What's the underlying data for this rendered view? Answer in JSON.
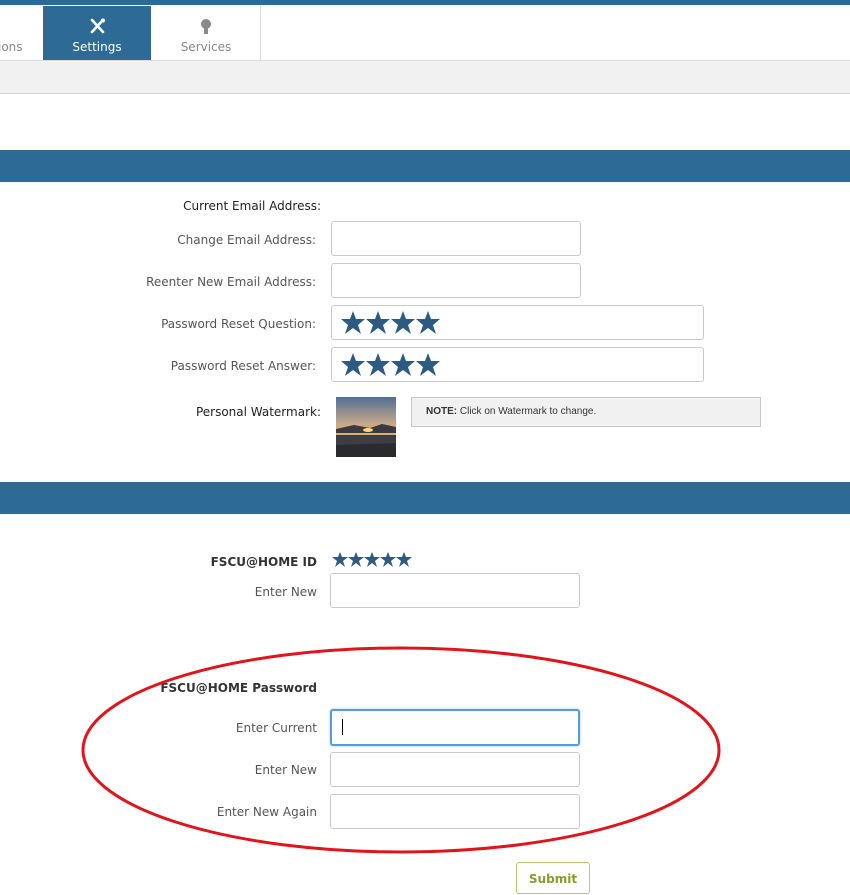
{
  "nav": {
    "tabs": [
      {
        "label": "ions"
      },
      {
        "label": "Settings"
      },
      {
        "label": "Services"
      }
    ],
    "active_color": "#2e6a96"
  },
  "profile": {
    "current_email_label": "Current Email Address:",
    "change_email_label": "Change Email Address:",
    "reenter_email_label": "Reenter New Email Address:",
    "reset_question_label": "Password Reset Question:",
    "reset_answer_label": "Password Reset Answer:",
    "watermark_label": "Personal Watermark:",
    "watermark_note_bold": "NOTE:",
    "watermark_note_text": " Click on Watermark to change."
  },
  "credentials": {
    "id_label": "FSCU@HOME ID",
    "id_enter_new_label": "Enter New",
    "password_label": "FSCU@HOME Password",
    "enter_current_label": "Enter Current",
    "enter_new_label": "Enter New",
    "enter_new_again_label": "Enter New Again",
    "submit_label": "Submit"
  },
  "colors": {
    "header": "#2e6a96",
    "star": "#2d5a80",
    "annotation": "#e0151c"
  }
}
